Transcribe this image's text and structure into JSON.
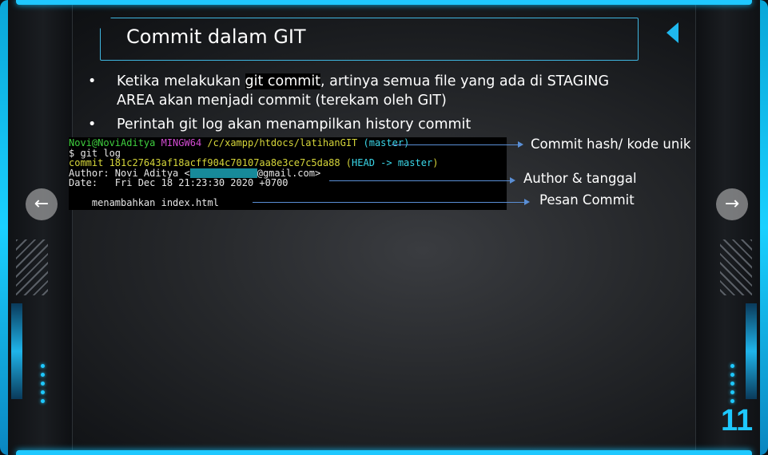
{
  "slide": {
    "title": "Commit dalam GIT",
    "bullets": [
      {
        "marker": "•",
        "pre": "Ketika melakukan ",
        "highlight": "git commit",
        "post": ", artinya semua file yang ada di STAGING AREA akan menjadi commit (terekam oleh GIT)"
      },
      {
        "marker": "•",
        "text": "Perintah git log akan menampilkan history commit"
      }
    ],
    "terminal": {
      "prompt_user": "Novi@NoviAditya",
      "prompt_env": "MINGW64",
      "prompt_path": "/c/xampp/htdocs/latihanGIT",
      "prompt_branch": "(master)",
      "command": "$ git log",
      "commit_label": "commit 181c27643af18acff904c70107aa8e3ce7c5da88",
      "commit_head_open": "(",
      "commit_head": "HEAD -> master",
      "commit_head_close": ")",
      "author_pre": "Author: Novi Aditya <",
      "author_post": "@gmail.com>",
      "date_line": "Date:   Fri Dec 18 21:23:30 2020 +0700",
      "message_line": "    menambahkan index.html"
    },
    "annotations": {
      "hash": "Commit hash/ kode unik",
      "author": "Author & tanggal",
      "message": "Pesan Commit"
    },
    "nav": {
      "prev_icon": "←",
      "next_icon": "→"
    },
    "page_number": "11",
    "colors": {
      "accent": "#1ec8ff",
      "terminal_bg": "#000000",
      "arrow": "#5a8fd6"
    }
  }
}
